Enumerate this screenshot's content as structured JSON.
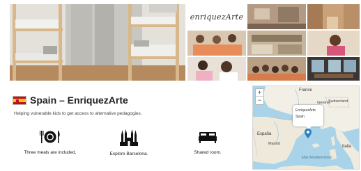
{
  "gallery": {
    "logo_text": "enriquezArte"
  },
  "listing": {
    "title": "Spain – EnriquezArte",
    "subtitle": "Helping vulnerable kids to get access to alternative pedagogies.",
    "flag_icon": "spain-flag-icon"
  },
  "features": [
    {
      "icon": "dinner-plate-icon",
      "label": "Three meals are included."
    },
    {
      "icon": "sagrada-familia-icon",
      "label": "Explore Barcelona."
    },
    {
      "icon": "bed-icon",
      "label": "Shared room."
    }
  ],
  "map": {
    "zoom_in": "+",
    "zoom_out": "−",
    "popup_title": "EnriquezArte",
    "popup_sub": "Spain",
    "labels": {
      "france": "France",
      "switzerland": "Switzerland",
      "geneva": "Genève",
      "spain": "España",
      "madrid": "Madrid",
      "italy": "Italia",
      "sea": "Mar Mediterráneo"
    },
    "colors": {
      "sea": "#a9d3e8",
      "land": "#f2efe6",
      "marker": "#2a7fc1"
    }
  }
}
